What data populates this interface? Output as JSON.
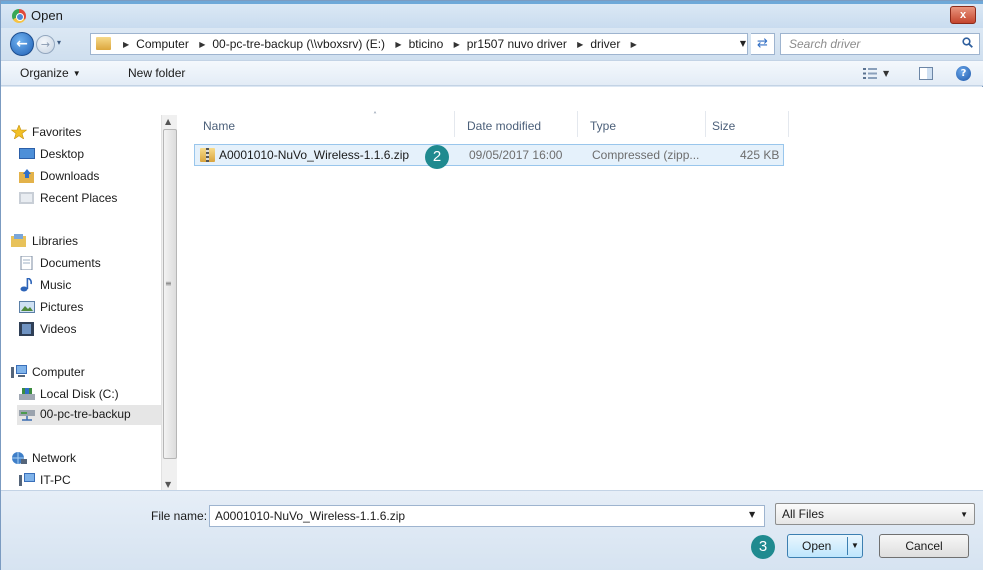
{
  "window": {
    "title": "Open",
    "close_label": "x"
  },
  "navigation": {
    "back_glyph": "←",
    "forward_glyph": "→",
    "recent_glyph": "▾",
    "breadcrumbs": [
      "Computer",
      "00-pc-tre-backup (\\\\vboxsrv) (E:)",
      "bticino",
      "pr1507 nuvo driver",
      "driver"
    ],
    "breadcrumb_separator": "▶",
    "dropdown_glyph": "▼",
    "refresh_glyph": "⇄",
    "search_placeholder": "Search driver"
  },
  "toolbar": {
    "organize_label": "Organize",
    "organize_caret": "▼",
    "new_folder_label": "New folder",
    "view_caret": "▼",
    "help_glyph": "?"
  },
  "sidebar": {
    "scroll_up": "▲",
    "scroll_down": "▼",
    "scroll_grip": "≡",
    "items": [
      {
        "label": "Favorites",
        "icon": "star-icon"
      },
      {
        "label": "Desktop",
        "icon": "desktop-icon"
      },
      {
        "label": "Downloads",
        "icon": "downloads-icon"
      },
      {
        "label": "Recent Places",
        "icon": "recent-places-icon"
      },
      {
        "label": "Libraries",
        "icon": "libraries-icon"
      },
      {
        "label": "Documents",
        "icon": "documents-icon"
      },
      {
        "label": "Music",
        "icon": "music-icon"
      },
      {
        "label": "Pictures",
        "icon": "pictures-icon"
      },
      {
        "label": "Videos",
        "icon": "videos-icon"
      },
      {
        "label": "Computer",
        "icon": "computer-icon"
      },
      {
        "label": "Local Disk (C:)",
        "icon": "disk-icon"
      },
      {
        "label": "00-pc-tre-backup",
        "icon": "network-drive-icon",
        "selected": true
      },
      {
        "label": "Network",
        "icon": "network-icon"
      },
      {
        "label": "IT-PC",
        "icon": "pc-icon"
      }
    ]
  },
  "file_list": {
    "sort_glyph": "˄",
    "columns": [
      "Name",
      "Date modified",
      "Type",
      "Size"
    ],
    "rows": [
      {
        "name": "A0001010-NuVo_Wireless-1.1.6.zip",
        "date": "09/05/2017 16:00",
        "type": "Compressed (zipp...",
        "size": "425 KB",
        "selected": true
      }
    ]
  },
  "footer": {
    "file_name_label": "File name:",
    "file_name_value": "A0001010-NuVo_Wireless-1.1.6.zip",
    "file_name_caret": "▼",
    "filter_value": "All Files",
    "filter_caret": "▼",
    "open_label": "Open",
    "open_caret": "▼",
    "cancel_label": "Cancel"
  },
  "step_badges": {
    "file_step": "2",
    "open_step": "3"
  },
  "colors": {
    "accent": "#1f8a8f",
    "selection": "#e5f1fb",
    "close": "#c4452d"
  }
}
